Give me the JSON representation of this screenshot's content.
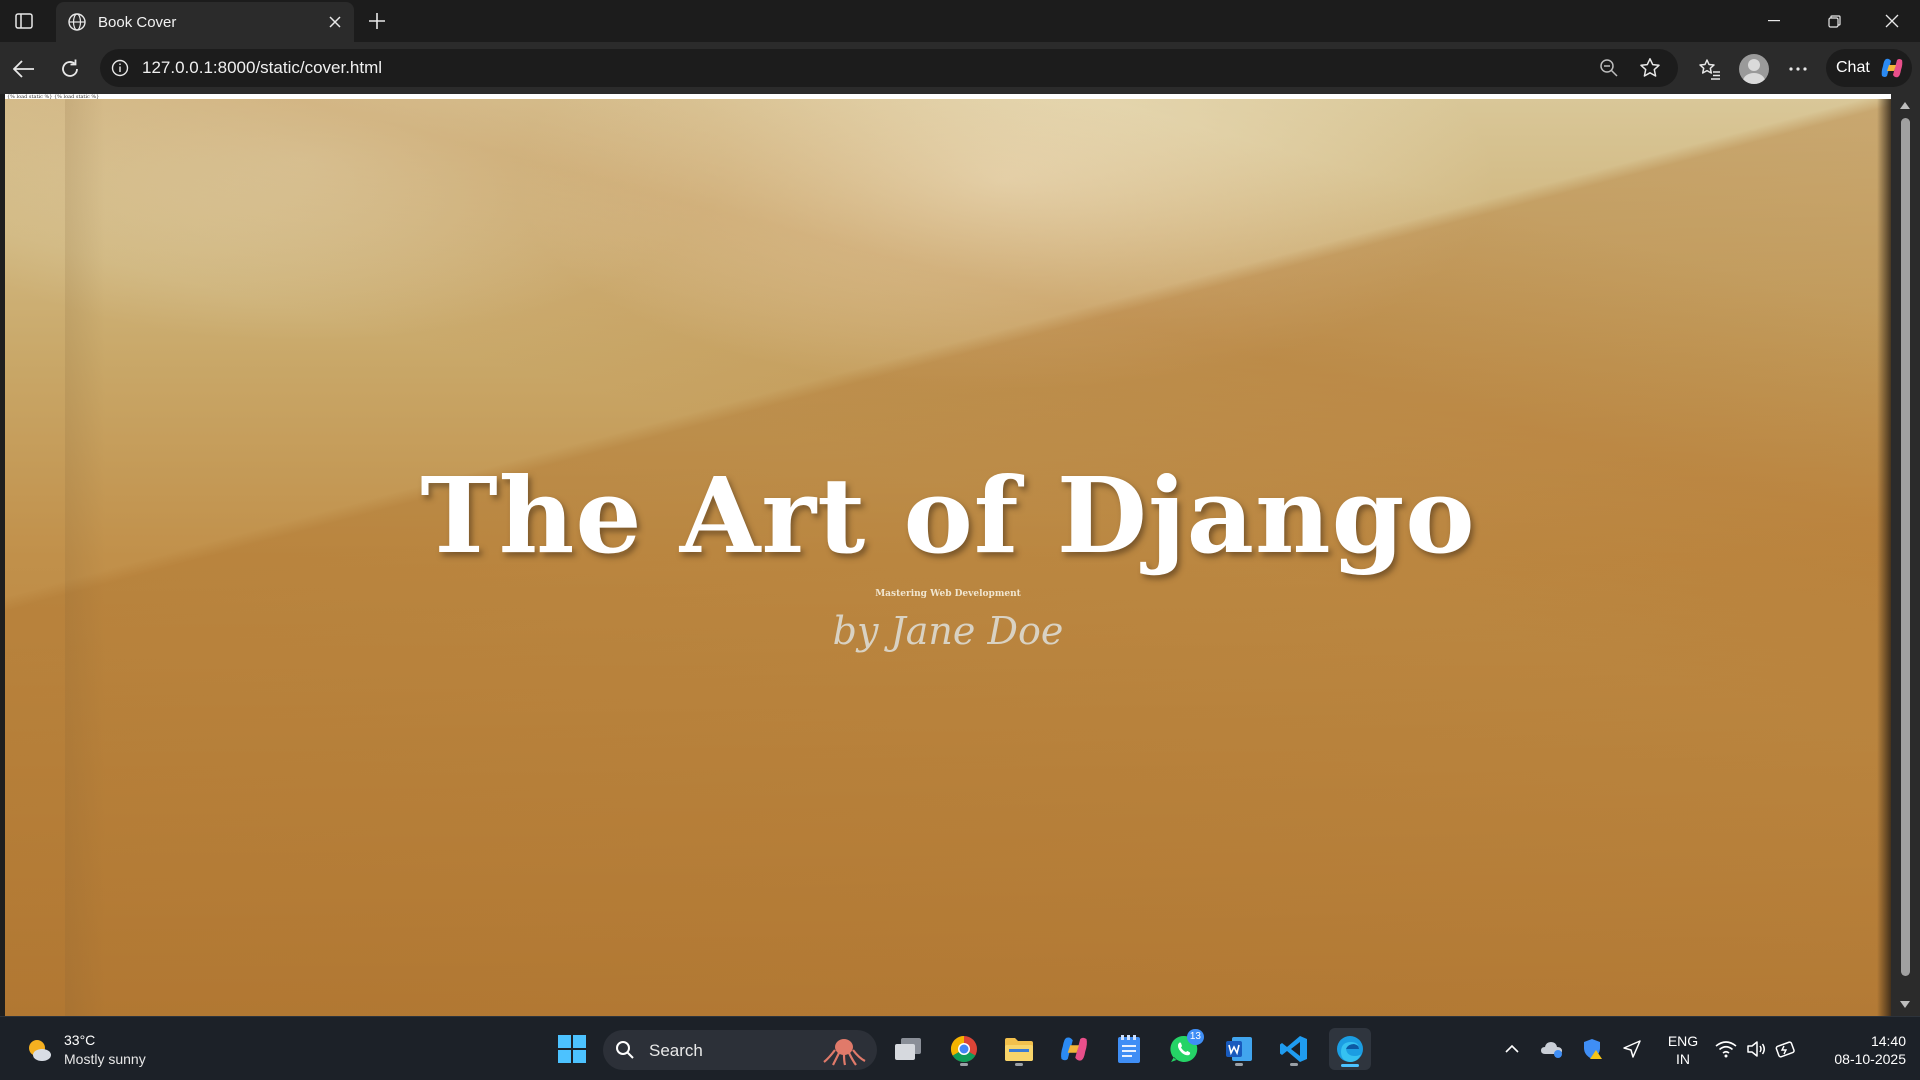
{
  "browser": {
    "tab_title": "Book Cover",
    "url": "127.0.0.1:8000/static/cover.html",
    "chat_label": "Chat"
  },
  "page": {
    "debug_text": "{% load static %} {% load static %}",
    "title": "The Art of Django",
    "subtitle": "Mastering Web Development",
    "author": "by Jane Doe",
    "colors": {
      "cover_light": "#d9c798",
      "cover_mid": "#c1904a",
      "cover_dark": "#b37a35",
      "title_color": "#ffffff",
      "author_color": "#d9d2c3"
    }
  },
  "taskbar": {
    "weather_temp": "33°C",
    "weather_condition": "Mostly sunny",
    "search_label": "Search",
    "whatsapp_badge": "13",
    "lang_line1": "ENG",
    "lang_line2": "IN",
    "time": "14:40",
    "date": "08-10-2025",
    "apps": [
      "task-view",
      "chrome",
      "file-explorer",
      "copilot",
      "notepad",
      "whatsapp",
      "word",
      "vscode",
      "edge"
    ]
  }
}
